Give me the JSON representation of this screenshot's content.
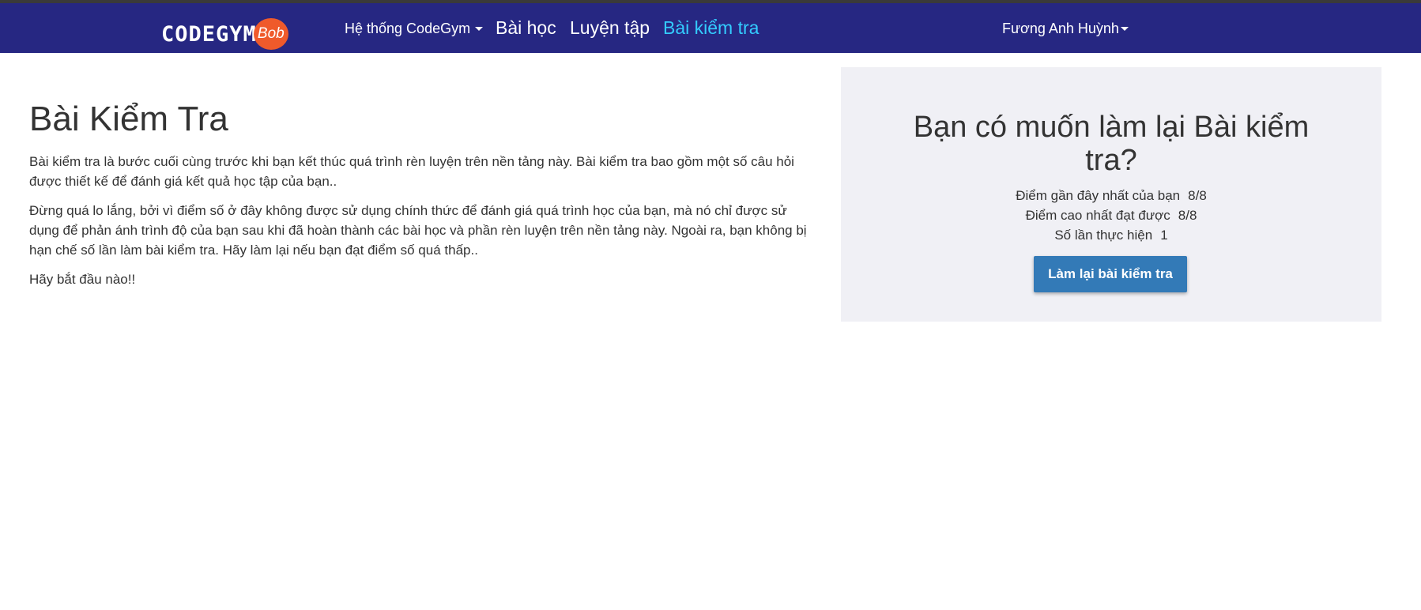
{
  "navbar": {
    "logo_text": "CODEGYM",
    "logo_badge": "Bob",
    "items": [
      {
        "label": "Hệ thống CodeGym"
      },
      {
        "label": "Bài học"
      },
      {
        "label": "Luyện tập"
      },
      {
        "label": "Bài kiểm tra"
      }
    ],
    "user_name": "Fương Anh Huỳnh",
    "active_color": "#33ccff",
    "bg_color": "#262782"
  },
  "main": {
    "title": "Bài Kiểm Tra",
    "paragraphs": [
      "Bài kiểm tra là bước cuối cùng trước khi bạn kết thúc quá trình rèn luyện trên nền tảng này. Bài kiểm tra bao gồm một số câu hỏi được thiết kế để đánh giá kết quả học tập của bạn..",
      "Đừng quá lo lắng, bởi vì điểm số ở đây không được sử dụng chính thức để đánh giá quá trình học của bạn, mà nó chỉ được sử dụng để phản ánh trình độ của bạn sau khi đã hoàn thành các bài học và phần rèn luyện trên nền tảng này. Ngoài ra, bạn không bị hạn chế số lần làm bài kiểm tra. Hãy làm lại nếu bạn đạt điểm số quá thấp..",
      "Hãy bắt đầu nào!!"
    ]
  },
  "panel": {
    "title": "Bạn có muốn làm lại Bài kiểm tra?",
    "stats": [
      {
        "label": "Điểm gần đây nhất của bạn",
        "value": "8/8"
      },
      {
        "label": "Điểm cao nhất đạt được",
        "value": "8/8"
      },
      {
        "label": "Số lần thực hiện",
        "value": "1"
      }
    ],
    "button_label": "Làm lại bài kiểm tra",
    "button_color": "#337ab7"
  }
}
